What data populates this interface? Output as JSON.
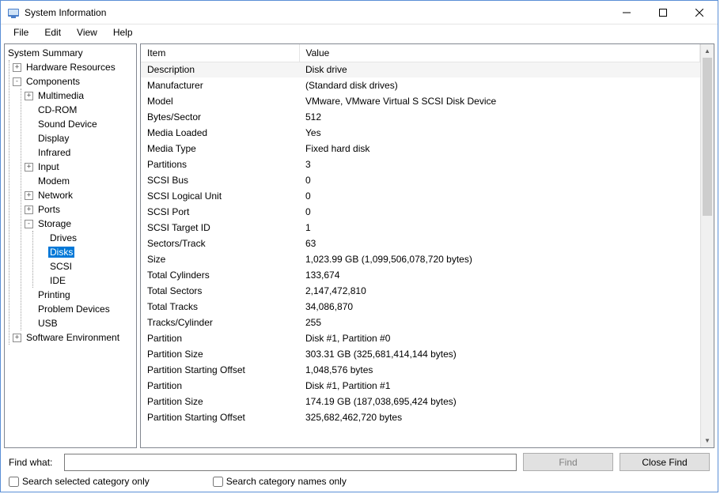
{
  "window": {
    "title": "System Information"
  },
  "menu": {
    "file": "File",
    "edit": "Edit",
    "view": "View",
    "help": "Help"
  },
  "tree": {
    "root": "System Summary",
    "hardware": "Hardware Resources",
    "components": "Components",
    "multimedia": "Multimedia",
    "cdrom": "CD-ROM",
    "sound": "Sound Device",
    "display": "Display",
    "infrared": "Infrared",
    "input": "Input",
    "modem": "Modem",
    "network": "Network",
    "ports": "Ports",
    "storage": "Storage",
    "drives": "Drives",
    "disks": "Disks",
    "scsi": "SCSI",
    "ide": "IDE",
    "printing": "Printing",
    "problem": "Problem Devices",
    "usb": "USB",
    "software": "Software Environment"
  },
  "columns": {
    "item": "Item",
    "value": "Value"
  },
  "rows": [
    {
      "item": "Description",
      "value": "Disk drive",
      "alt": true
    },
    {
      "item": "Manufacturer",
      "value": "(Standard disk drives)"
    },
    {
      "item": "Model",
      "value": "VMware, VMware Virtual S SCSI Disk Device"
    },
    {
      "item": "Bytes/Sector",
      "value": "512"
    },
    {
      "item": "Media Loaded",
      "value": "Yes"
    },
    {
      "item": "Media Type",
      "value": "Fixed hard disk"
    },
    {
      "item": "Partitions",
      "value": "3"
    },
    {
      "item": "SCSI Bus",
      "value": "0"
    },
    {
      "item": "SCSI Logical Unit",
      "value": "0"
    },
    {
      "item": "SCSI Port",
      "value": "0"
    },
    {
      "item": "SCSI Target ID",
      "value": "1"
    },
    {
      "item": "Sectors/Track",
      "value": "63"
    },
    {
      "item": "Size",
      "value": "1,023.99 GB (1,099,506,078,720 bytes)"
    },
    {
      "item": "Total Cylinders",
      "value": "133,674"
    },
    {
      "item": "Total Sectors",
      "value": "2,147,472,810"
    },
    {
      "item": "Total Tracks",
      "value": "34,086,870"
    },
    {
      "item": "Tracks/Cylinder",
      "value": "255"
    },
    {
      "item": "Partition",
      "value": "Disk #1, Partition #0"
    },
    {
      "item": "Partition Size",
      "value": "303.31 GB (325,681,414,144 bytes)"
    },
    {
      "item": "Partition Starting Offset",
      "value": "1,048,576 bytes"
    },
    {
      "item": "Partition",
      "value": "Disk #1, Partition #1"
    },
    {
      "item": "Partition Size",
      "value": "174.19 GB (187,038,695,424 bytes)"
    },
    {
      "item": "Partition Starting Offset",
      "value": "325,682,462,720 bytes"
    }
  ],
  "footer": {
    "find_label": "Find what:",
    "find_value": "",
    "find_btn": "Find",
    "close_btn": "Close Find",
    "check_selected": "Search selected category only",
    "check_names": "Search category names only"
  }
}
